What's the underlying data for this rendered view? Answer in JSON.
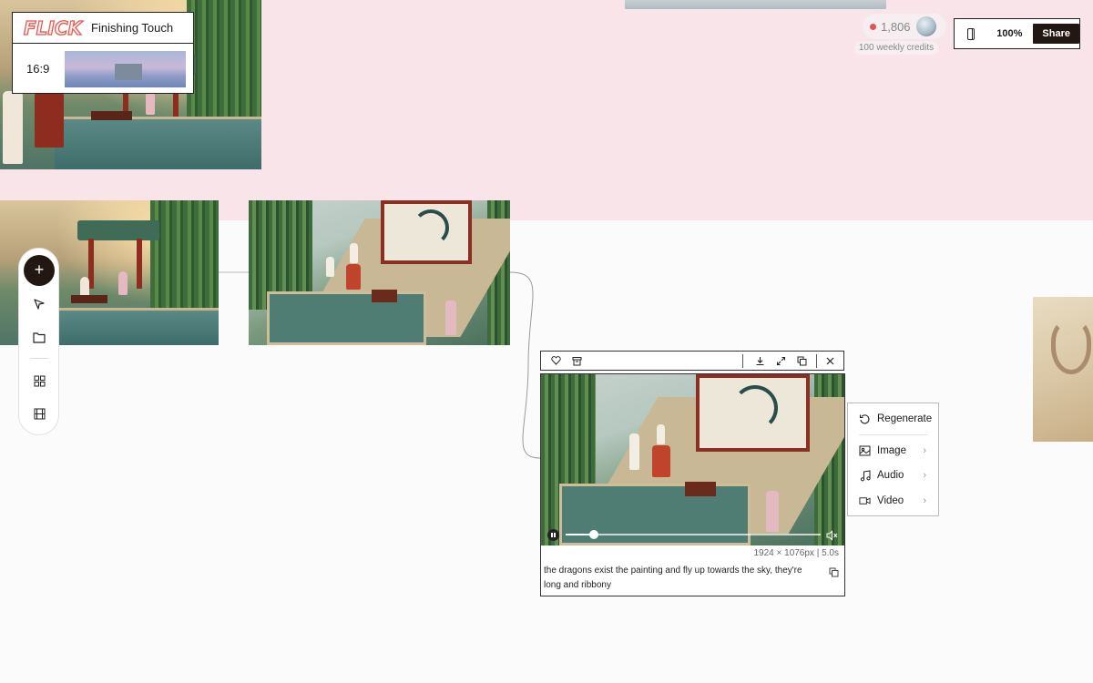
{
  "project": {
    "logo_text": "FLICK",
    "title": "Finishing Touch",
    "aspect_ratio": "16:9"
  },
  "credits": {
    "amount": "1,806",
    "weekly": "100 weekly credits"
  },
  "topbar": {
    "zoom": "100%",
    "share_label": "Share"
  },
  "tool_rail": {
    "add_label": "+"
  },
  "selected_node": {
    "dimensions": "1924 × 1076px | 5.0s",
    "prompt": "the dragons exist the painting and fly up towards the sky, they're long and ribbony",
    "playback_progress": 0.11
  },
  "context_menu": {
    "items": [
      {
        "label": "Regenerate",
        "icon": "regenerate-icon"
      },
      {
        "label": "Image",
        "icon": "image-icon"
      },
      {
        "label": "Audio",
        "icon": "music-note-icon"
      },
      {
        "label": "Video",
        "icon": "video-camera-icon"
      }
    ]
  },
  "colors": {
    "accent_dark": "#231714",
    "credit_dot": "#e8534a",
    "group_band": "#f9e4ea"
  }
}
